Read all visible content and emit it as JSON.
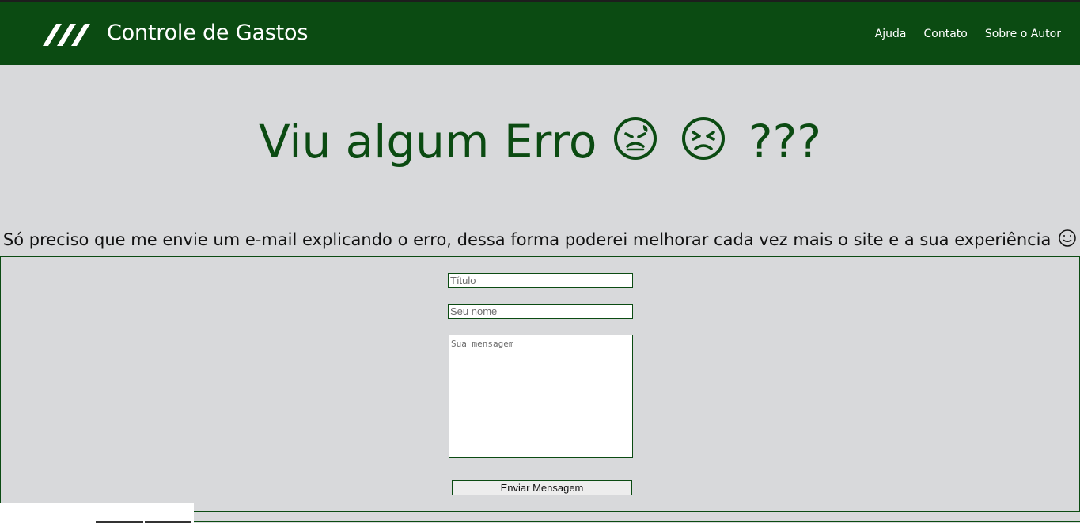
{
  "header": {
    "brand": "Controle de Gastos",
    "nav": [
      "Ajuda",
      "Contato",
      "Sobre o Autor"
    ],
    "logo_icon": "stripes-logo"
  },
  "hero": {
    "title_text": "Viu algum Erro",
    "title_suffix": "???",
    "icons": [
      "sweating-face-icon",
      "sad-squint-face-icon"
    ]
  },
  "subtitle": {
    "text": "Só preciso que me envie um e-mail explicando o erro, dessa forma poderei melhorar cada vez mais o site e a sua experiência",
    "icon": "smile-icon"
  },
  "form": {
    "title_placeholder": "Título",
    "name_placeholder": "Seu nome",
    "message_placeholder": "Sua mensagem",
    "submit_label": "Enviar Mensagem"
  },
  "colors": {
    "primary": "#0b4b12",
    "background": "#d8d9db",
    "text": "#111111",
    "white": "#ffffff"
  }
}
